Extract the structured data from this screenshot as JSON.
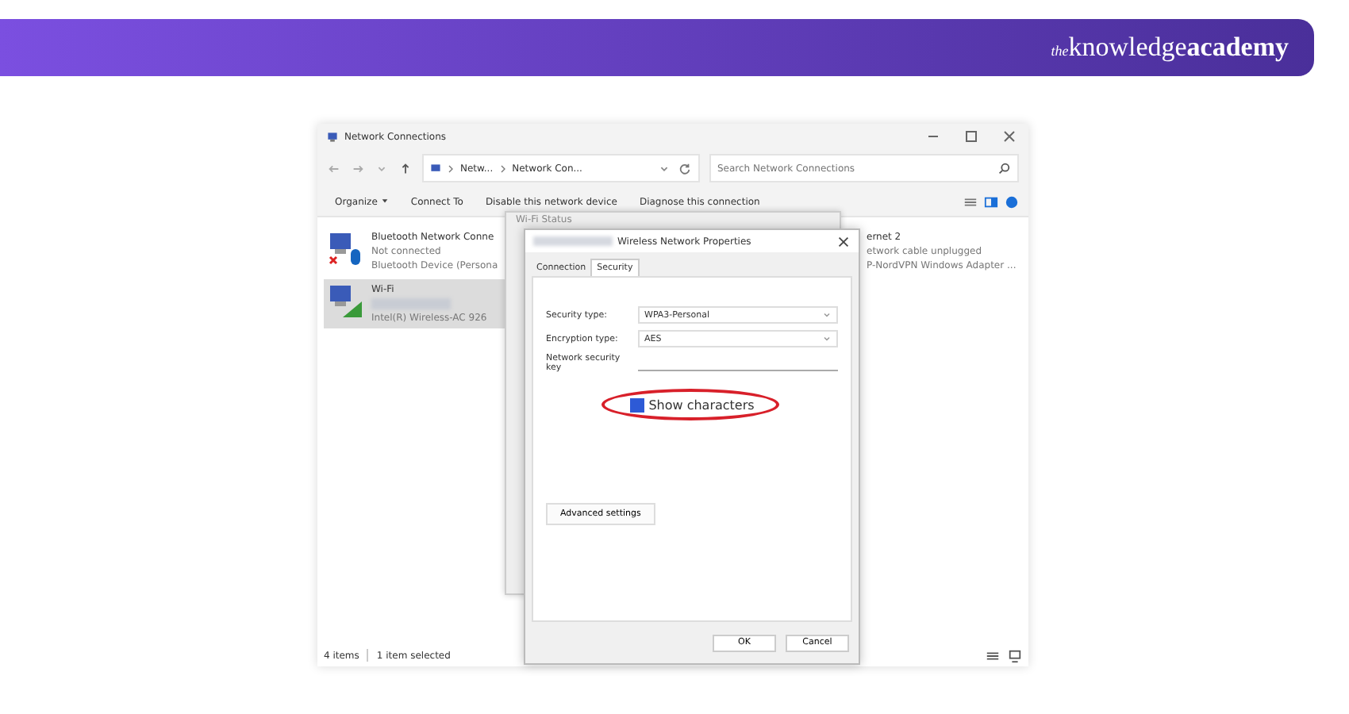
{
  "banner": {
    "logo": {
      "prefix": "the",
      "main": "knowledge",
      "bold": "academy"
    }
  },
  "window": {
    "title": "Network Connections",
    "breadcrumbs": [
      "Netw...",
      "Network Con..."
    ],
    "search": {
      "placeholder": "Search Network Connections"
    },
    "commands": [
      {
        "label": "Organize",
        "dropdown": true
      },
      {
        "label": "Connect To",
        "dropdown": false
      },
      {
        "label": "Disable this network device",
        "dropdown": false
      },
      {
        "label": "Diagnose this connection",
        "dropdown": false
      }
    ],
    "items": [
      {
        "kind": "bluetooth",
        "selected": false,
        "name": "Bluetooth Network Conne",
        "status": "Not connected",
        "device": "Bluetooth Device (Persona"
      },
      {
        "kind": "wifi",
        "selected": true,
        "name": "Wi-Fi",
        "device": "Intel(R) Wireless-AC 926"
      }
    ],
    "right_item": {
      "name": "ernet 2",
      "status": "etwork cable unplugged",
      "device": "P-NordVPN Windows Adapter ..."
    },
    "status_bar": {
      "count": "4 items",
      "selection": "1 item selected"
    }
  },
  "status_dialog": {
    "title": "Wi-Fi Status"
  },
  "dialog": {
    "title": "Wireless Network Properties",
    "tabs": [
      {
        "label": "Connection",
        "selected": false
      },
      {
        "label": "Security",
        "selected": true
      }
    ],
    "fields": [
      {
        "kind": "select",
        "label": "Security type:",
        "value": "WPA3-Personal"
      },
      {
        "kind": "select",
        "label": "Encryption type:",
        "value": "AES"
      },
      {
        "kind": "input",
        "label": "Network security key"
      }
    ],
    "show_characters": {
      "label": "Show characters",
      "checked": true,
      "highlighted": true
    },
    "advanced_button": "Advanced settings",
    "buttons": [
      "OK",
      "Cancel"
    ]
  }
}
